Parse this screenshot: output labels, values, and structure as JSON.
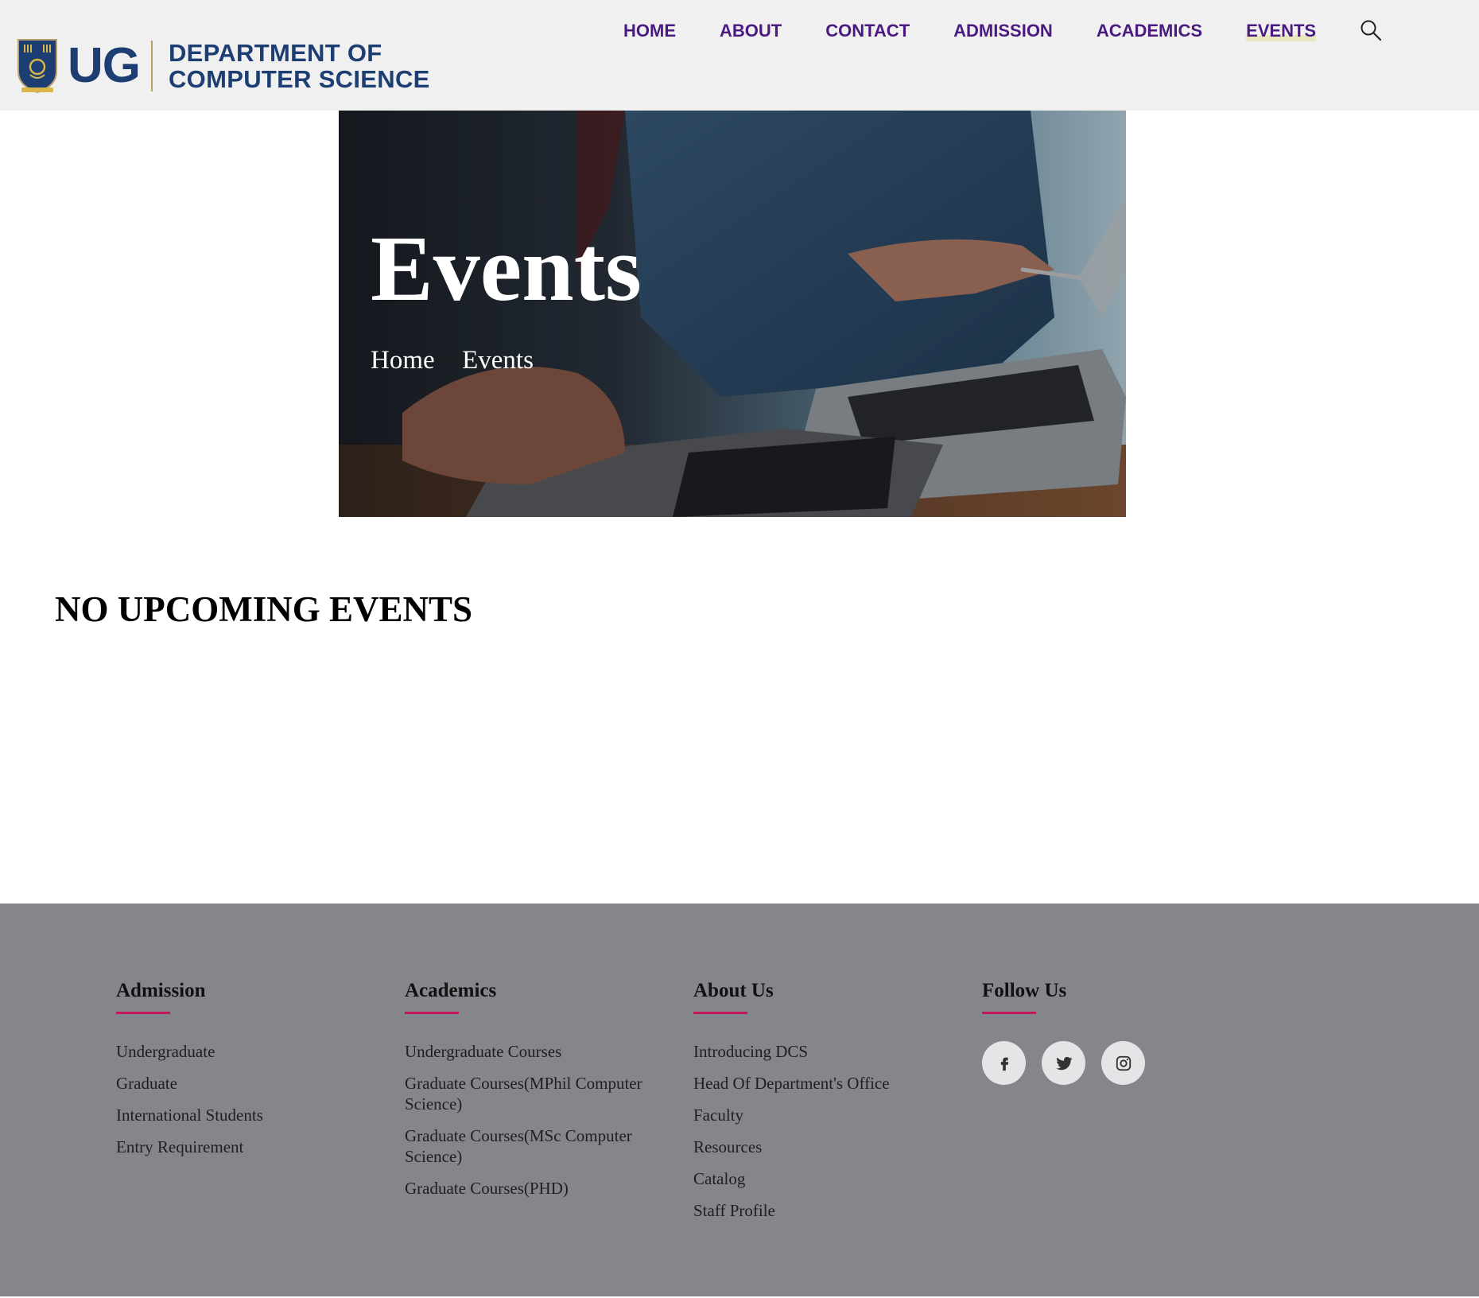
{
  "header": {
    "logo_ug": "UG",
    "logo_line1": "DEPARTMENT OF",
    "logo_line2": "COMPUTER SCIENCE",
    "nav": [
      "HOME",
      "ABOUT",
      "CONTACT",
      "ADMISSION",
      "ACADEMICS",
      "EVENTS"
    ],
    "active_nav": "EVENTS",
    "search_icon": "search-icon"
  },
  "hero": {
    "title": "Events",
    "breadcrumb": [
      "Home",
      "Events"
    ],
    "breadcrumb_separator": "⇨"
  },
  "main": {
    "message": "NO UPCOMING EVENTS"
  },
  "footer": {
    "columns": [
      {
        "heading": "Admission",
        "links": [
          "Undergraduate",
          "Graduate",
          "International Students",
          "Entry Requirement"
        ]
      },
      {
        "heading": "Academics",
        "links": [
          "Undergraduate Courses",
          "Graduate Courses(MPhil Computer Science)",
          "Graduate Courses(MSc Computer Science)",
          "Graduate Courses(PHD)"
        ]
      },
      {
        "heading": "About Us",
        "links": [
          "Introducing DCS",
          "Head Of Department's Office",
          "Faculty",
          "Resources",
          "Catalog",
          "Staff Profile"
        ]
      },
      {
        "heading": "Follow Us",
        "social": [
          "facebook-icon",
          "twitter-icon",
          "instagram-icon"
        ]
      }
    ]
  },
  "colors": {
    "nav_text": "#4a1a80",
    "brand_blue": "#1d3e72",
    "footer_bg": "#85868b",
    "accent_underline": "#c2185b"
  }
}
